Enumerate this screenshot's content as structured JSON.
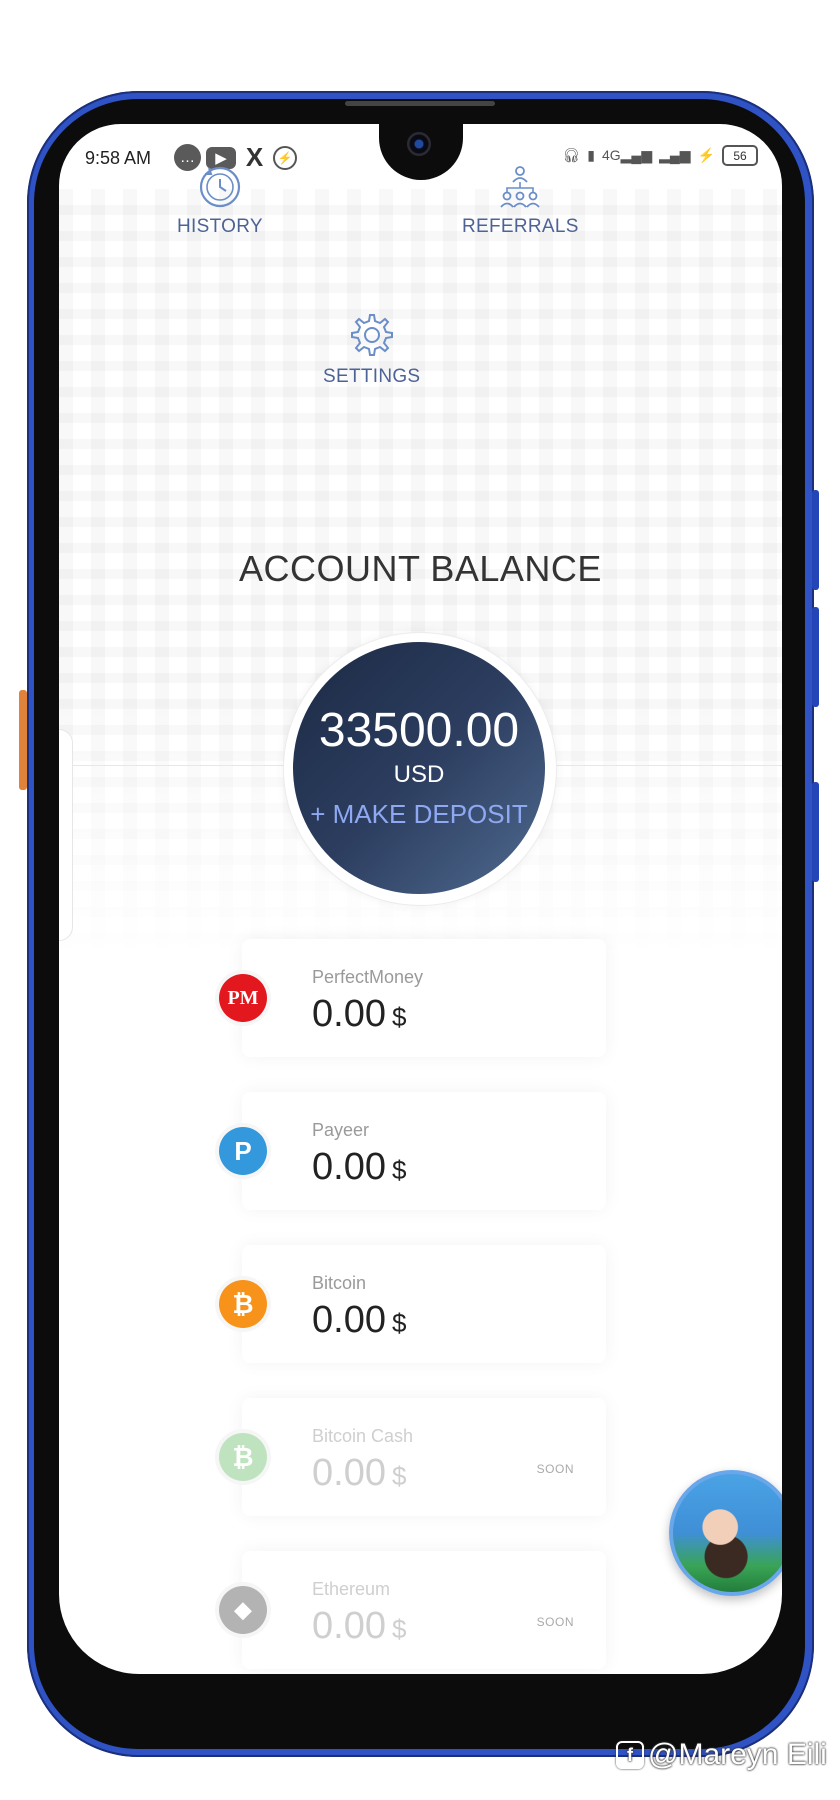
{
  "status": {
    "time": "9:58 AM",
    "icons_left": [
      "message-icon",
      "youtube-icon",
      "x-icon",
      "messenger-icon"
    ],
    "icons_right": [
      "headphones-icon",
      "vibrate-icon",
      "signal-4g-icon",
      "signal-icon",
      "charging-icon"
    ],
    "network": "4G",
    "battery": "56"
  },
  "nav": {
    "history": "HISTORY",
    "referrals": "REFERRALS",
    "settings": "SETTINGS"
  },
  "balance": {
    "title": "ACCOUNT BALANCE",
    "amount": "33500.00",
    "currency": "USD",
    "deposit": "+ MAKE DEPOSIT"
  },
  "wallets": [
    {
      "name": "PerfectMoney",
      "amount": "0.00",
      "unit": "$",
      "icon_text": "PM",
      "icon_color": "#e3171e",
      "soon": ""
    },
    {
      "name": "Payeer",
      "amount": "0.00",
      "unit": "$",
      "icon_text": "P",
      "icon_color": "#3398dc",
      "soon": ""
    },
    {
      "name": "Bitcoin",
      "amount": "0.00",
      "unit": "$",
      "icon_text": "₿",
      "icon_color": "#f7931a",
      "soon": ""
    },
    {
      "name": "Bitcoin Cash",
      "amount": "0.00",
      "unit": "$",
      "icon_text": "₿",
      "icon_color": "#bfe3bf",
      "soon": "SOON"
    },
    {
      "name": "Ethereum",
      "amount": "0.00",
      "unit": "$",
      "icon_text": "◆",
      "icon_color": "#b3b3b3",
      "soon": "SOON"
    }
  ],
  "watermark": "@Mareyn Eili",
  "colors": {
    "frame": "#2f53c5",
    "accent": "#4d6396",
    "balance_circle": "#1b2a44",
    "deposit": "#8ea8f2"
  }
}
